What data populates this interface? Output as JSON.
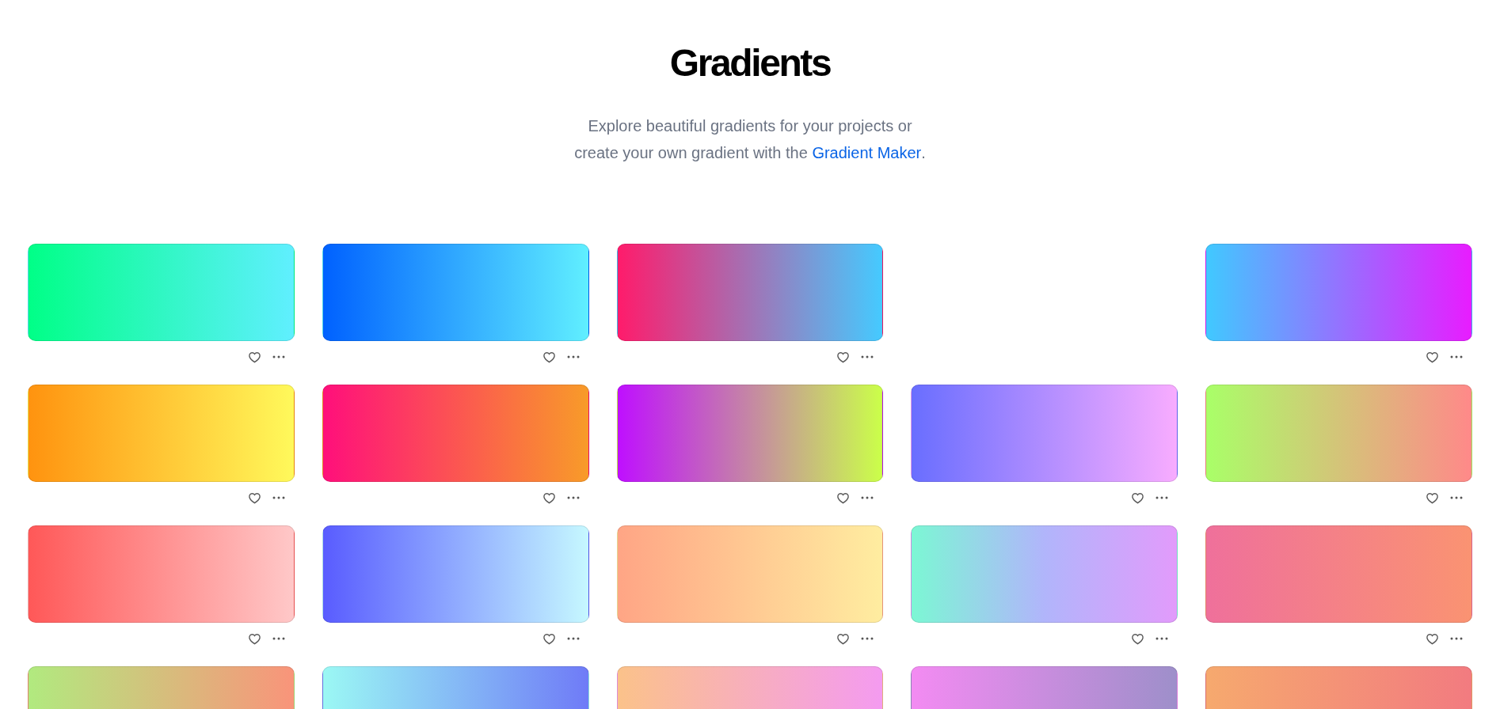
{
  "title": "Gradients",
  "subtitle": {
    "line_1": "Explore beautiful gradients for your projects or",
    "line_2": "create your own gradient with the ",
    "link": "Gradient Maker",
    "end": "."
  },
  "gradients": [
    {
      "kind": "gradient",
      "stops": [
        {
          "color": "#00ff87"
        },
        {
          "color": "#60efff"
        }
      ]
    },
    {
      "kind": "gradient",
      "stops": [
        {
          "color": "#0061ff"
        },
        {
          "color": "#60efff"
        }
      ]
    },
    {
      "kind": "gradient",
      "stops": [
        {
          "color": "#ff1b6b"
        },
        {
          "color": "#45caff"
        }
      ]
    },
    {
      "kind": "blank"
    },
    {
      "kind": "gradient",
      "stops": [
        {
          "color": "#40c9ff"
        },
        {
          "color": "#e81cff"
        }
      ]
    },
    {
      "kind": "gradient",
      "stops": [
        {
          "color": "#ff930f"
        },
        {
          "color": "#fff95b"
        }
      ]
    },
    {
      "kind": "gradient",
      "stops": [
        {
          "color": "#ff0f7b"
        },
        {
          "color": "#f89b29"
        }
      ]
    },
    {
      "kind": "gradient",
      "stops": [
        {
          "color": "#bf0fff"
        },
        {
          "color": "#cbff49"
        }
      ]
    },
    {
      "kind": "gradient",
      "stops": [
        {
          "color": "#696eff"
        },
        {
          "color": "#f8acff"
        }
      ]
    },
    {
      "kind": "gradient",
      "stops": [
        {
          "color": "#a9ff68"
        },
        {
          "color": "#ff8989"
        }
      ]
    },
    {
      "kind": "gradient",
      "stops": [
        {
          "color": "#ff5858"
        },
        {
          "color": "#ffc8c8"
        }
      ]
    },
    {
      "kind": "gradient",
      "stops": [
        {
          "color": "#595cff"
        },
        {
          "color": "#c6f8ff"
        }
      ]
    },
    {
      "kind": "gradient",
      "stops": [
        {
          "color": "#ffa585"
        },
        {
          "color": "#ffeda0"
        }
      ]
    },
    {
      "kind": "gradient",
      "stops": [
        {
          "color": "#7cf7d4"
        },
        {
          "color": "#b1b5fb"
        },
        {
          "color": "#e29bfb"
        }
      ]
    },
    {
      "kind": "gradient",
      "stops": [
        {
          "color": "#ef709b"
        },
        {
          "color": "#fa9372"
        }
      ]
    },
    {
      "kind": "gradient",
      "stops": [
        {
          "color": "#b1ea7f"
        },
        {
          "color": "#f9947a"
        }
      ]
    },
    {
      "kind": "gradient",
      "stops": [
        {
          "color": "#9bf8f4"
        },
        {
          "color": "#6f7bf7"
        }
      ]
    },
    {
      "kind": "gradient",
      "stops": [
        {
          "color": "#fbc28a"
        },
        {
          "color": "#f49bf0"
        }
      ]
    },
    {
      "kind": "gradient",
      "stops": [
        {
          "color": "#f38bf2"
        },
        {
          "color": "#9e8fca"
        }
      ]
    },
    {
      "kind": "gradient",
      "stops": [
        {
          "color": "#f6a96e"
        },
        {
          "color": "#f27b80"
        }
      ]
    }
  ]
}
